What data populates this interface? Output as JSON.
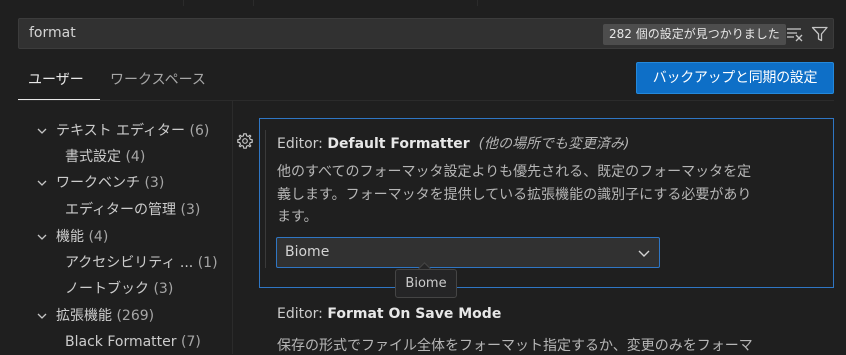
{
  "search": {
    "value": "format",
    "result_count": "282 個の設定が見つかりました",
    "filter_icons": [
      "clear-filter-icon",
      "filter-icon"
    ]
  },
  "tabs": [
    {
      "label": "ユーザー",
      "active": true
    },
    {
      "label": "ワークスペース",
      "active": false
    }
  ],
  "sync_button": {
    "label": "バックアップと同期の設定"
  },
  "toc": [
    {
      "label": "テキスト エディター",
      "count": "(6)",
      "expanded": true,
      "level": 0
    },
    {
      "label": "書式設定",
      "count": "(4)",
      "level": 1
    },
    {
      "label": "ワークベンチ",
      "count": "(3)",
      "expanded": true,
      "level": 0
    },
    {
      "label": "エディターの管理",
      "count": "(3)",
      "level": 1
    },
    {
      "label": "機能",
      "count": "(4)",
      "expanded": true,
      "level": 0
    },
    {
      "label": "アクセシビリティ ...",
      "count": "(1)",
      "level": 1
    },
    {
      "label": "ノートブック",
      "count": "(3)",
      "level": 1
    },
    {
      "label": "拡張機能",
      "count": "(269)",
      "expanded": true,
      "level": 0
    },
    {
      "label": "Black Formatter",
      "count": "(7)",
      "level": 1
    }
  ],
  "settings": [
    {
      "category": "Editor: ",
      "name": "Default Formatter",
      "modified_note": "(他の場所でも変更済み)",
      "description_lines": [
        "他のすべてのフォーマッタ設定よりも優先される、既定のフォーマッタを定",
        "義します。フォーマッタを提供している拡張機能の識別子にする必要があり",
        "ます。"
      ],
      "select_value": "Biome",
      "tooltip": "Biome"
    },
    {
      "category": "Editor: ",
      "name": "Format On Save Mode",
      "description_lines": [
        "保存の形式でファイル全体をフォーマット指定するか、変更のみをフォーマ"
      ]
    }
  ],
  "colors": {
    "background": "#1f1f1f",
    "accent": "#0e6fc7",
    "focus_border": "#2f76c4"
  }
}
